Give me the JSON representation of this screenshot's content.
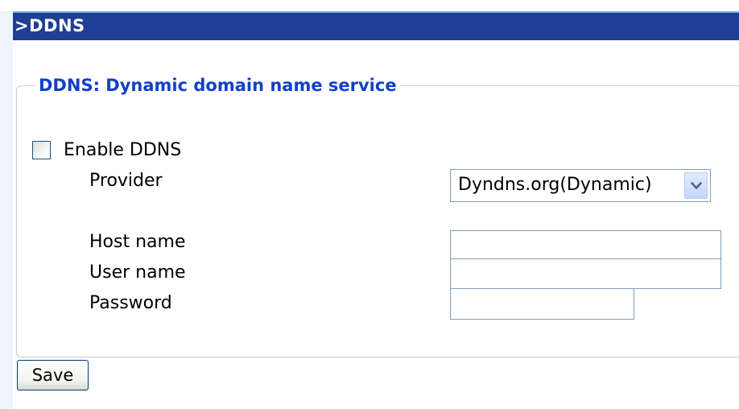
{
  "header": {
    "title": ">DDNS"
  },
  "section": {
    "legend": "DDNS: Dynamic domain name service",
    "enable": {
      "label": "Enable DDNS",
      "checked": false
    },
    "provider": {
      "label": "Provider",
      "selected": "Dyndns.org(Dynamic)",
      "icon": "chevron-down-icon"
    },
    "host_name": {
      "label": "Host name",
      "value": ""
    },
    "user_name": {
      "label": "User name",
      "value": ""
    },
    "password": {
      "label": "Password",
      "value": ""
    }
  },
  "actions": {
    "save_label": "Save"
  },
  "colors": {
    "title_bar": "#1f3f94",
    "legend_text": "#1240c8",
    "input_border": "#7f9db9"
  }
}
